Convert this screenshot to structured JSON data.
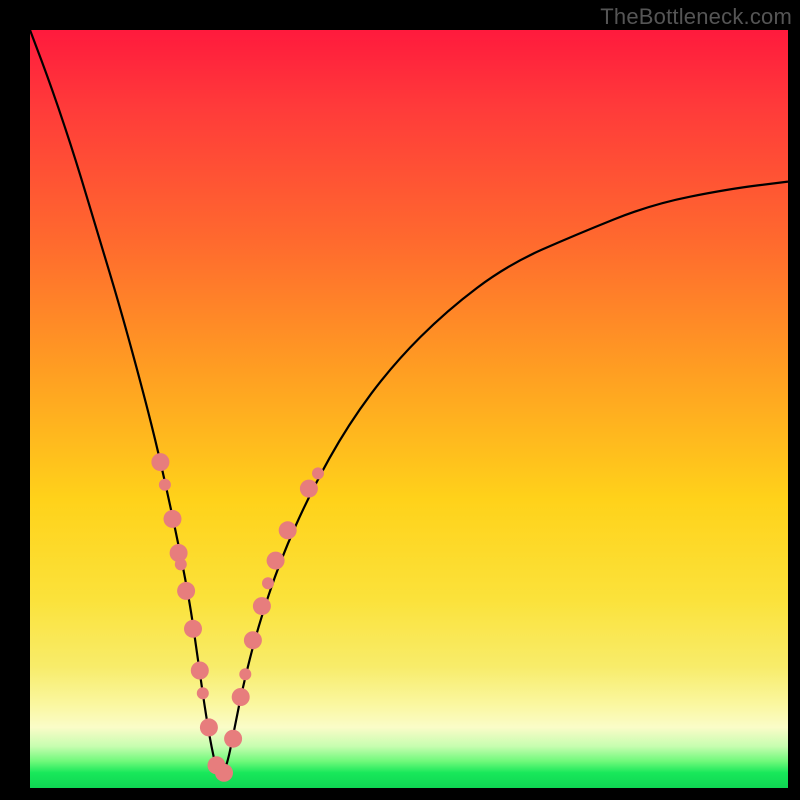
{
  "watermark": "TheBottleneck.com",
  "chart_data": {
    "type": "line",
    "title": "",
    "xlabel": "",
    "ylabel": "",
    "xlim": [
      0,
      100
    ],
    "ylim": [
      0,
      100
    ],
    "note": "Bottleneck-style V-curve. x is normalized component ratio, y is bottleneck percentage. Minimum (optimal match) near x≈25.",
    "series": [
      {
        "name": "bottleneck-curve",
        "x": [
          0,
          3,
          6,
          9,
          12,
          15,
          17,
          19,
          21,
          22,
          23,
          24,
          25,
          26,
          27,
          28,
          30,
          33,
          37,
          42,
          48,
          55,
          63,
          72,
          82,
          92,
          100
        ],
        "y": [
          100,
          92,
          83,
          73,
          63,
          52,
          44,
          35,
          25,
          18,
          11,
          5,
          1,
          3,
          8,
          13,
          21,
          30,
          39,
          48,
          56,
          63,
          69,
          73,
          77,
          79,
          80
        ]
      }
    ],
    "scatter": {
      "name": "sample-points",
      "color": "#e77d7d",
      "radius_main": 9,
      "radius_small": 6,
      "points": [
        {
          "x": 17.2,
          "y": 43.0,
          "r": 9
        },
        {
          "x": 17.8,
          "y": 40.0,
          "r": 6
        },
        {
          "x": 18.8,
          "y": 35.5,
          "r": 9
        },
        {
          "x": 19.6,
          "y": 31.0,
          "r": 9
        },
        {
          "x": 19.9,
          "y": 29.5,
          "r": 6
        },
        {
          "x": 20.6,
          "y": 26.0,
          "r": 9
        },
        {
          "x": 21.5,
          "y": 21.0,
          "r": 9
        },
        {
          "x": 22.4,
          "y": 15.5,
          "r": 9
        },
        {
          "x": 22.8,
          "y": 12.5,
          "r": 6
        },
        {
          "x": 23.6,
          "y": 8.0,
          "r": 9
        },
        {
          "x": 24.6,
          "y": 3.0,
          "r": 9
        },
        {
          "x": 25.6,
          "y": 2.0,
          "r": 9
        },
        {
          "x": 26.8,
          "y": 6.5,
          "r": 9
        },
        {
          "x": 27.8,
          "y": 12.0,
          "r": 9
        },
        {
          "x": 28.4,
          "y": 15.0,
          "r": 6
        },
        {
          "x": 29.4,
          "y": 19.5,
          "r": 9
        },
        {
          "x": 30.6,
          "y": 24.0,
          "r": 9
        },
        {
          "x": 31.4,
          "y": 27.0,
          "r": 6
        },
        {
          "x": 32.4,
          "y": 30.0,
          "r": 9
        },
        {
          "x": 34.0,
          "y": 34.0,
          "r": 9
        },
        {
          "x": 36.8,
          "y": 39.5,
          "r": 9
        },
        {
          "x": 38.0,
          "y": 41.5,
          "r": 6
        }
      ]
    },
    "gradient_stops": [
      {
        "pos": 0,
        "color": "#ff1a3d"
      },
      {
        "pos": 0.45,
        "color": "#ff9e22"
      },
      {
        "pos": 0.75,
        "color": "#fbe23a"
      },
      {
        "pos": 0.92,
        "color": "#fafcc8"
      },
      {
        "pos": 1.0,
        "color": "#0fd553"
      }
    ]
  }
}
